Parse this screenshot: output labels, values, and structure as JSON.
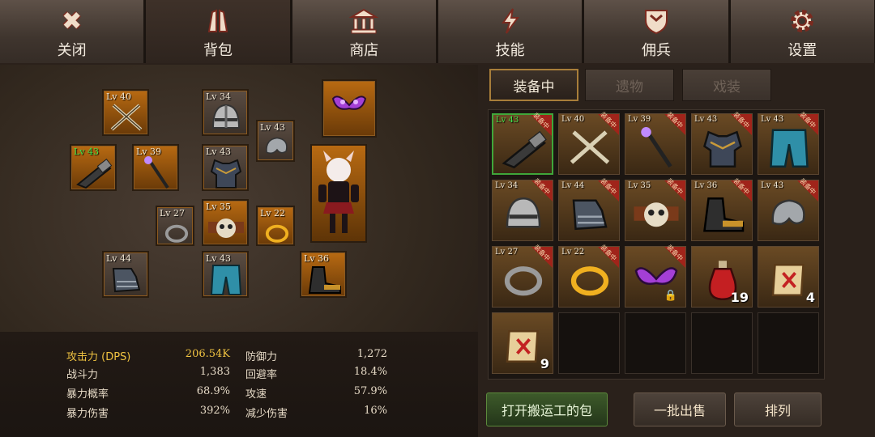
{
  "nav": {
    "tabs": [
      {
        "label": "关闭",
        "icon": "close-icon"
      },
      {
        "label": "背包",
        "icon": "backpack-icon"
      },
      {
        "label": "商店",
        "icon": "shop-icon"
      },
      {
        "label": "技能",
        "icon": "skill-bolt-icon"
      },
      {
        "label": "佣兵",
        "icon": "mercenary-shield-icon"
      },
      {
        "label": "设置",
        "icon": "gear-icon"
      }
    ],
    "active": "背包"
  },
  "equipment": {
    "slots": [
      {
        "name": "weapon-crossed-swords",
        "level": "Lv 40"
      },
      {
        "name": "helmet",
        "level": "Lv 34"
      },
      {
        "name": "wings-accessory",
        "level": ""
      },
      {
        "name": "pauldron",
        "level": "Lv 43"
      },
      {
        "name": "offhand-cannon",
        "level": "Lv 43"
      },
      {
        "name": "staff",
        "level": "Lv 39"
      },
      {
        "name": "chest-armor",
        "level": "Lv 43"
      },
      {
        "name": "ring",
        "level": "Lv 27"
      },
      {
        "name": "belt-skull",
        "level": "Lv 35"
      },
      {
        "name": "gold-ring",
        "level": "Lv 22"
      },
      {
        "name": "gauntlets",
        "level": "Lv 44"
      },
      {
        "name": "leg-armor",
        "level": "Lv 43"
      },
      {
        "name": "boots",
        "level": "Lv 36"
      }
    ]
  },
  "stats": [
    {
      "label": "攻击力 (DPS)",
      "value": "206.54K"
    },
    {
      "label": "战斗力",
      "value": "1,383"
    },
    {
      "label": "暴力概率",
      "value": "68.9%"
    },
    {
      "label": "暴力伤害",
      "value": "392%"
    },
    {
      "label": "防御力",
      "value": "1,272"
    },
    {
      "label": "回避率",
      "value": "18.4%"
    },
    {
      "label": "攻速",
      "value": "57.9%"
    },
    {
      "label": "减少伤害",
      "value": "16%"
    }
  ],
  "inventory": {
    "tabs": [
      "装备中",
      "遗物",
      "戏装"
    ],
    "active_tab": "装备中",
    "equipped_badge": "装备中",
    "items": [
      {
        "level": "Lv 43",
        "icon": "offhand-cannon-icon",
        "equipped": true,
        "selected": true
      },
      {
        "level": "Lv 40",
        "icon": "crossed-swords-icon",
        "equipped": true
      },
      {
        "level": "Lv 39",
        "icon": "staff-icon",
        "equipped": true
      },
      {
        "level": "Lv 43",
        "icon": "chest-armor-icon",
        "equipped": true
      },
      {
        "level": "Lv 43",
        "icon": "leg-armor-icon",
        "equipped": true
      },
      {
        "level": "Lv 34",
        "icon": "helmet-icon",
        "equipped": true
      },
      {
        "level": "Lv 44",
        "icon": "gauntlets-icon",
        "equipped": true
      },
      {
        "level": "Lv 35",
        "icon": "skull-belt-icon",
        "equipped": true
      },
      {
        "level": "Lv 36",
        "icon": "boots-icon",
        "equipped": true
      },
      {
        "level": "Lv 43",
        "icon": "pauldron-icon",
        "equipped": true
      },
      {
        "level": "Lv 27",
        "icon": "ring-icon",
        "equipped": true
      },
      {
        "level": "Lv 22",
        "icon": "gold-ring-icon",
        "equipped": true
      },
      {
        "level": "",
        "icon": "wings-icon",
        "equipped": true,
        "locked": true
      },
      {
        "level": "",
        "icon": "red-potion-icon",
        "count": "19"
      },
      {
        "level": "",
        "icon": "scroll-icon",
        "count": "4"
      },
      {
        "level": "",
        "icon": "scroll-icon",
        "count": "9"
      }
    ],
    "total_cells": 20
  },
  "buttons": {
    "open_porter_bag": "打开搬运工的包",
    "bulk_sell": "一批出售",
    "sort": "排列"
  }
}
